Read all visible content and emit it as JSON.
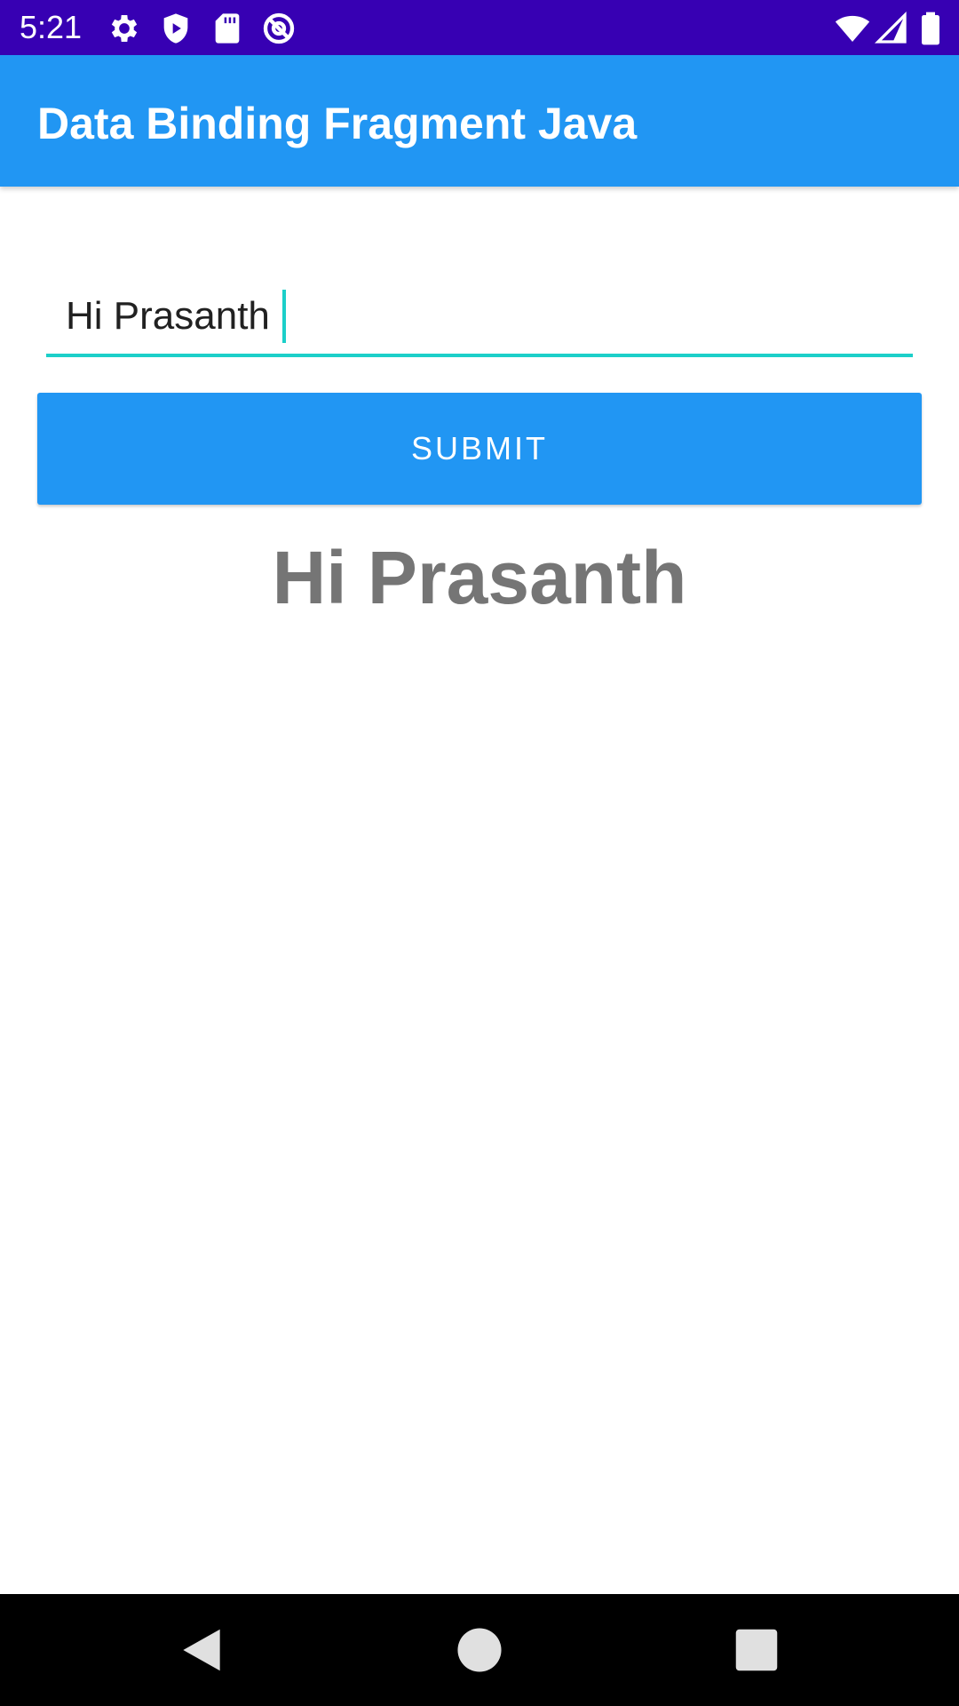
{
  "status_bar": {
    "time": "5:21",
    "left_icons": [
      "settings-icon",
      "shield-play-icon",
      "sd-card-icon",
      "at-sign-icon"
    ],
    "right_icons": [
      "wifi-icon",
      "signal-icon",
      "battery-icon"
    ],
    "background_color": "#3700b3"
  },
  "app_bar": {
    "title": "Data Binding Fragment Java",
    "background_color": "#2196f3"
  },
  "form": {
    "input_value": "Hi Prasanth",
    "accent_color": "#1ccfc9",
    "submit_label": "SUBMIT",
    "button_color": "#2196f3"
  },
  "output": {
    "text": "Hi Prasanth",
    "color": "#757575"
  },
  "nav_bar": {
    "buttons": [
      "back-icon",
      "home-icon",
      "recents-icon"
    ]
  }
}
